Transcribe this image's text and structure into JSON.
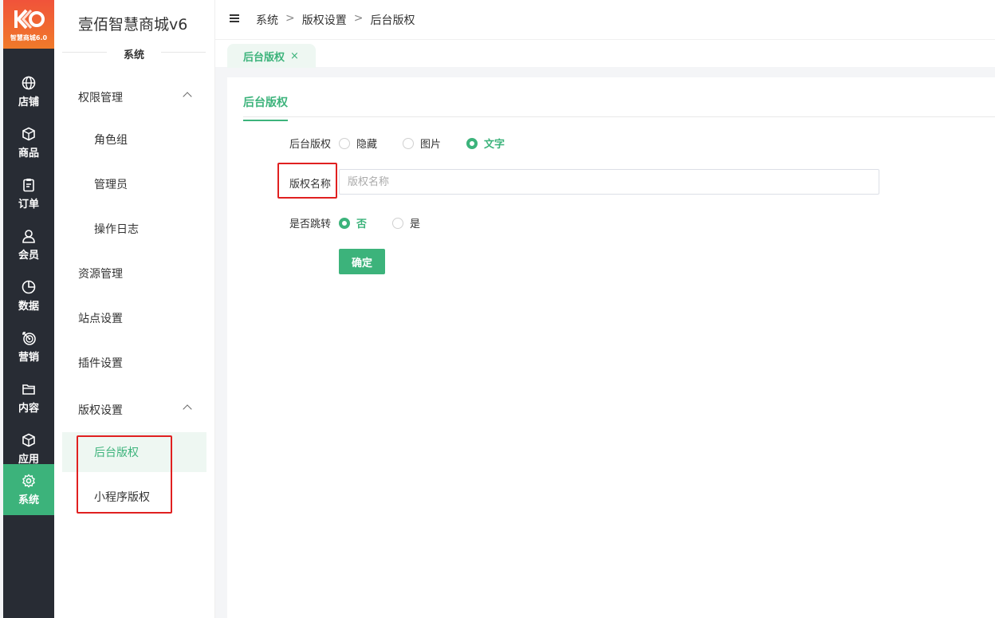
{
  "logo": {
    "text": "智慧商城6.0"
  },
  "rail": {
    "items": [
      {
        "label": "店铺",
        "icon": "globe-icon",
        "active": false
      },
      {
        "label": "商品",
        "icon": "box-icon",
        "active": false
      },
      {
        "label": "订单",
        "icon": "clipboard-icon",
        "active": false
      },
      {
        "label": "会员",
        "icon": "user-icon",
        "active": false
      },
      {
        "label": "数据",
        "icon": "pie-chart-icon",
        "active": false
      },
      {
        "label": "营销",
        "icon": "target-icon",
        "active": false
      },
      {
        "label": "内容",
        "icon": "folder-icon",
        "active": false
      },
      {
        "label": "应用",
        "icon": "cube-icon",
        "active": false
      },
      {
        "label": "系统",
        "icon": "gear-icon",
        "active": true
      }
    ]
  },
  "subnav": {
    "brand": "壹佰智慧商城v6",
    "section": "系统",
    "items": [
      {
        "label": "权限管理",
        "level": 0,
        "expanded": true
      },
      {
        "label": "角色组",
        "level": 1
      },
      {
        "label": "管理员",
        "level": 1
      },
      {
        "label": "操作日志",
        "level": 1
      },
      {
        "label": "资源管理",
        "level": 0
      },
      {
        "label": "站点设置",
        "level": 0
      },
      {
        "label": "插件设置",
        "level": 0
      },
      {
        "label": "版权设置",
        "level": 0,
        "expanded": true
      },
      {
        "label": "后台版权",
        "level": 1,
        "selected": true
      },
      {
        "label": "小程序版权",
        "level": 1
      }
    ]
  },
  "breadcrumb": {
    "items": [
      "系统",
      "版权设置",
      "后台版权"
    ],
    "separator": ">"
  },
  "tabs": {
    "active_label": "后台版权",
    "close": "×"
  },
  "panel": {
    "tab": "后台版权",
    "copyright_label": "后台版权",
    "copyright_options": [
      {
        "label": "隐藏",
        "checked": false
      },
      {
        "label": "图片",
        "checked": false
      },
      {
        "label": "文字",
        "checked": true
      }
    ],
    "name_label": "版权名称",
    "name_value": "",
    "name_placeholder": "版权名称",
    "jump_label": "是否跳转",
    "jump_options": [
      {
        "label": "否",
        "checked": true
      },
      {
        "label": "是",
        "checked": false
      }
    ],
    "submit_label": "确定"
  },
  "colors": {
    "accent": "#3cb37b",
    "rail_bg": "#282c34",
    "highlight": "#e02020"
  }
}
